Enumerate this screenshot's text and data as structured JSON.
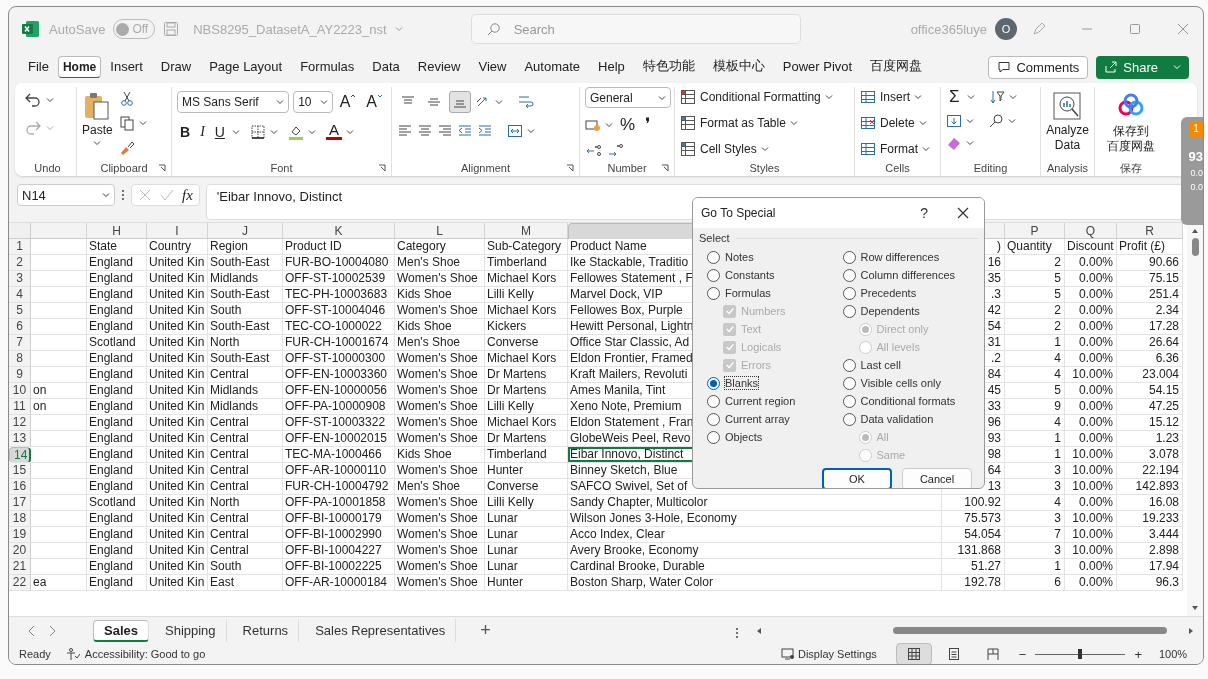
{
  "title_bar": {
    "autosave_label": "AutoSave",
    "autosave_toggle": {
      "on": false,
      "label": "Off"
    },
    "file_name": "NBS8295_DatasetA_AY2223_nst",
    "search_placeholder": "Search",
    "user": "office365luye",
    "avatar_initial": "O"
  },
  "menu_tabs": [
    {
      "label": "File",
      "selected": false
    },
    {
      "label": "Home",
      "selected": true
    },
    {
      "label": "Insert",
      "selected": false
    },
    {
      "label": "Draw",
      "selected": false
    },
    {
      "label": "Page Layout",
      "selected": false
    },
    {
      "label": "Formulas",
      "selected": false
    },
    {
      "label": "Data",
      "selected": false
    },
    {
      "label": "Review",
      "selected": false
    },
    {
      "label": "View",
      "selected": false
    },
    {
      "label": "Automate",
      "selected": false
    },
    {
      "label": "Help",
      "selected": false
    },
    {
      "label": "特色功能",
      "selected": false
    },
    {
      "label": "模板中心",
      "selected": false
    },
    {
      "label": "Power Pivot",
      "selected": false
    },
    {
      "label": "百度网盘",
      "selected": false
    }
  ],
  "comments_button": "Comments",
  "share_button": "Share",
  "ribbon": {
    "group_labels": [
      "Undo",
      "Clipboard",
      "Font",
      "Alignment",
      "Number",
      "Styles",
      "Cells",
      "Editing",
      "Analysis",
      "保存"
    ],
    "paste_label": "Paste",
    "font_name": "MS Sans Serif",
    "font_size": "10",
    "grow_font": "A",
    "shrink_font": "A",
    "style_buttons": [
      "B",
      "I",
      "U"
    ],
    "font_color": "A",
    "vertical_align": [
      {
        "kind": "top",
        "selected": false
      },
      {
        "kind": "middle",
        "selected": false
      },
      {
        "kind": "bottom",
        "selected": true
      }
    ],
    "number_format": "General",
    "percent": "%",
    "comma": "❜",
    "styles": [
      "Conditional Formatting",
      "Format as Table",
      "Cell Styles"
    ],
    "cells": [
      "Insert",
      "Delete",
      "Format"
    ],
    "autosum": "Σ",
    "analyze_data": "Analyze\nData",
    "baidu_save": [
      "保存到",
      "百度网盘"
    ]
  },
  "formula_bar": {
    "name_box": "N14",
    "fx": "fx",
    "content": "'Eibar Innovo, Distinct"
  },
  "sheet": {
    "column_letters": [
      "H",
      "I",
      "J",
      "K",
      "L",
      "M",
      "P",
      "Q",
      "R"
    ],
    "header_row": {
      "num": "1",
      "state": "State",
      "country": "Country",
      "region": "Region",
      "product_id": "Product ID",
      "category": "Category",
      "sub_category": "Sub-Category",
      "product_name": "Product Name",
      "column_o": ")",
      "quantity": "Quantity",
      "discount": "Discount",
      "profit": "Profit (£)"
    },
    "rows": [
      {
        "num": "2",
        "selected": false,
        "state": "England",
        "country": "United Kin",
        "region": "South-East",
        "product_id": "FUR-BO-10004080",
        "category": "Men's Shoe",
        "sub_category": "Timberland",
        "product_name": "Ike Stackable, Traditio",
        "column_o": "16",
        "quantity": "2",
        "discount": "0.00%",
        "profit": "90.66"
      },
      {
        "num": "3",
        "selected": false,
        "state": "England",
        "country": "United Kin",
        "region": "Midlands",
        "product_id": "OFF-ST-10002539",
        "category": "Women's Shoe",
        "sub_category": "Michael Kors",
        "product_name": "Fellowes Statement , F",
        "column_o": "35",
        "quantity": "5",
        "discount": "0.00%",
        "profit": "75.15"
      },
      {
        "num": "4",
        "selected": false,
        "state": "England",
        "country": "United Kin",
        "region": "South-East",
        "product_id": "TEC-PH-10003683",
        "category": "Kids Shoe",
        "sub_category": "Lilli Kelly",
        "product_name": "Marvel Dock, VIP",
        "column_o": ".3",
        "quantity": "5",
        "discount": "0.00%",
        "profit": "251.4"
      },
      {
        "num": "5",
        "selected": false,
        "state": "England",
        "country": "United Kin",
        "region": "South",
        "product_id": "OFF-ST-10004046",
        "category": "Women's Shoe",
        "sub_category": "Michael Kors",
        "product_name": "Fellowes Box, Purple",
        "column_o": "42",
        "quantity": "2",
        "discount": "0.00%",
        "profit": "2.34"
      },
      {
        "num": "6",
        "selected": false,
        "state": "England",
        "country": "United Kin",
        "region": "South-East",
        "product_id": "TEC-CO-1000022",
        "category": "Kids Shoe",
        "sub_category": "Kickers",
        "product_name": "Hewitt Personal, Lightn",
        "column_o": "54",
        "quantity": "2",
        "discount": "0.00%",
        "profit": "17.28"
      },
      {
        "num": "7",
        "selected": false,
        "state": "Scotland",
        "country": "United Kin",
        "region": "North",
        "product_id": "FUR-CH-10001674",
        "category": "Men's Shoe",
        "sub_category": "Converse",
        "product_name": "Office Star Classic, Ad",
        "column_o": "31",
        "quantity": "1",
        "discount": "0.00%",
        "profit": "26.64"
      },
      {
        "num": "8",
        "selected": false,
        "state": "England",
        "country": "United Kin",
        "region": "South-East",
        "product_id": "OFF-ST-10000300",
        "category": "Women's Shoe",
        "sub_category": "Michael Kors",
        "product_name": "Eldon Frontier, Framed",
        "column_o": ".2",
        "quantity": "4",
        "discount": "0.00%",
        "profit": "6.36"
      },
      {
        "num": "9",
        "selected": false,
        "state": "England",
        "country": "United Kin",
        "region": "Central",
        "product_id": "OFF-EN-10003360",
        "category": "Women's Shoe",
        "sub_category": "Dr Martens",
        "product_name": "Kraft Mailers, Revoluti",
        "column_o": "84",
        "quantity": "4",
        "discount": "10.00%",
        "profit": "23.004"
      },
      {
        "num": "10",
        "selected": false,
        "column_g": "on",
        "state": "England",
        "country": "United Kin",
        "region": "Midlands",
        "product_id": "OFF-EN-10000056",
        "category": "Women's Shoe",
        "sub_category": "Dr Martens",
        "product_name": "Ames Manila, Tint",
        "column_o": "45",
        "quantity": "5",
        "discount": "0.00%",
        "profit": "54.15"
      },
      {
        "num": "11",
        "selected": false,
        "column_g": "on",
        "state": "England",
        "country": "United Kin",
        "region": "Midlands",
        "product_id": "OFF-PA-10000908",
        "category": "Women's Shoe",
        "sub_category": "Lilli Kelly",
        "product_name": "Xeno Note, Premium",
        "column_o": "33",
        "quantity": "9",
        "discount": "0.00%",
        "profit": "47.25"
      },
      {
        "num": "12",
        "selected": false,
        "state": "England",
        "country": "United Kin",
        "region": "Central",
        "product_id": "OFF-ST-10003322",
        "category": "Women's Shoe",
        "sub_category": "Michael Kors",
        "product_name": "Eldon Statement , Fran",
        "column_o": "96",
        "quantity": "4",
        "discount": "0.00%",
        "profit": "15.12"
      },
      {
        "num": "13",
        "selected": false,
        "state": "England",
        "country": "United Kin",
        "region": "Central",
        "product_id": "OFF-EN-10002015",
        "category": "Women's Shoe",
        "sub_category": "Dr Martens",
        "product_name": "GlobeWeis Peel, Revo",
        "column_o": "93",
        "quantity": "1",
        "discount": "0.00%",
        "profit": "1.23"
      },
      {
        "num": "14",
        "selected": true,
        "state": "England",
        "country": "United Kin",
        "region": "Central",
        "product_id": "TEC-MA-1000466",
        "category": "Kids Shoe",
        "sub_category": "Timberland",
        "product_name": "Eibar Innovo, Distinct",
        "column_o": "98",
        "quantity": "1",
        "discount": "10.00%",
        "profit": "3.078"
      },
      {
        "num": "15",
        "selected": false,
        "state": "England",
        "country": "United Kin",
        "region": "Central",
        "product_id": "OFF-AR-10000110",
        "category": "Women's Shoe",
        "sub_category": "Hunter",
        "product_name": "Binney Sketch, Blue",
        "column_o": "64",
        "quantity": "3",
        "discount": "10.00%",
        "profit": "22.194"
      },
      {
        "num": "16",
        "selected": false,
        "state": "England",
        "country": "United Kin",
        "region": "Central",
        "product_id": "FUR-CH-10004792",
        "category": "Men's Shoe",
        "sub_category": "Converse",
        "product_name": "SAFCO Swivel, Set of",
        "column_o": "13",
        "quantity": "3",
        "discount": "10.00%",
        "profit": "142.893"
      },
      {
        "num": "17",
        "selected": false,
        "state": "Scotland",
        "country": "United Kin",
        "region": "North",
        "product_id": "OFF-PA-10001858",
        "category": "Women's Shoe",
        "sub_category": "Lilli Kelly",
        "product_name": "Sandy Chapter, Multicolor",
        "column_o": "100.92",
        "quantity": "4",
        "discount": "0.00%",
        "profit": "16.08"
      },
      {
        "num": "18",
        "selected": false,
        "state": "England",
        "country": "United Kin",
        "region": "Central",
        "product_id": "OFF-BI-10000179",
        "category": "Women's Shoe",
        "sub_category": "Lunar",
        "product_name": "Wilson Jones 3-Hole, Economy",
        "column_o": "75.573",
        "quantity": "3",
        "discount": "10.00%",
        "profit": "19.233"
      },
      {
        "num": "19",
        "selected": false,
        "state": "England",
        "country": "United Kin",
        "region": "Central",
        "product_id": "OFF-BI-10002990",
        "category": "Women's Shoe",
        "sub_category": "Lunar",
        "product_name": "Acco Index, Clear",
        "column_o": "54.054",
        "quantity": "7",
        "discount": "10.00%",
        "profit": "3.444"
      },
      {
        "num": "20",
        "selected": false,
        "state": "England",
        "country": "United Kin",
        "region": "Central",
        "product_id": "OFF-BI-10004227",
        "category": "Women's Shoe",
        "sub_category": "Lunar",
        "product_name": "Avery Brooke, Economy",
        "column_o": "131.868",
        "quantity": "3",
        "discount": "10.00%",
        "profit": "2.898"
      },
      {
        "num": "21",
        "selected": false,
        "state": "England",
        "country": "United Kin",
        "region": "South",
        "product_id": "OFF-BI-10002225",
        "category": "Women's Shoe",
        "sub_category": "Lunar",
        "product_name": "Cardinal Brooke, Durable",
        "column_o": "51.27",
        "quantity": "1",
        "discount": "0.00%",
        "profit": "17.94"
      },
      {
        "num": "22",
        "selected": false,
        "column_g": "ea",
        "state": "England",
        "country": "United Kin",
        "region": "East",
        "product_id": "OFF-AR-10000184",
        "category": "Women's Shoe",
        "sub_category": "Hunter",
        "product_name": "Boston Sharp, Water Color",
        "column_o": "192.78",
        "quantity": "6",
        "discount": "0.00%",
        "profit": "96.3"
      }
    ]
  },
  "dialog": {
    "title": "Go To Special",
    "help": "?",
    "section": "Select",
    "columns": [
      [
        {
          "kind": "radio",
          "label": "Notes",
          "selected": false
        },
        {
          "kind": "radio",
          "label": "Constants",
          "selected": false
        },
        {
          "kind": "radio",
          "label": "Formulas",
          "selected": false,
          "children": [
            {
              "kind": "checkbox",
              "label": "Numbers",
              "checked": true,
              "disabled": true
            },
            {
              "kind": "checkbox",
              "label": "Text",
              "checked": true,
              "disabled": true
            },
            {
              "kind": "checkbox",
              "label": "Logicals",
              "checked": true,
              "disabled": true
            },
            {
              "kind": "checkbox",
              "label": "Errors",
              "checked": true,
              "disabled": true
            }
          ]
        },
        {
          "kind": "radio",
          "label": "Blanks",
          "selected": true
        },
        {
          "kind": "radio",
          "label": "Current region",
          "selected": false
        },
        {
          "kind": "radio",
          "label": "Current array",
          "selected": false
        },
        {
          "kind": "radio",
          "label": "Objects",
          "selected": false
        }
      ],
      [
        {
          "kind": "radio",
          "label": "Row differences",
          "selected": false
        },
        {
          "kind": "radio",
          "label": "Column differences",
          "selected": false
        },
        {
          "kind": "radio",
          "label": "Precedents",
          "selected": false
        },
        {
          "kind": "radio",
          "label": "Dependents",
          "selected": false,
          "children": [
            {
              "kind": "radio",
              "label": "Direct only",
              "selected": true,
              "disabled": true
            },
            {
              "kind": "radio",
              "label": "All levels",
              "selected": false,
              "disabled": true
            }
          ]
        },
        {
          "kind": "radio",
          "label": "Last cell",
          "selected": false
        },
        {
          "kind": "radio",
          "label": "Visible cells only",
          "selected": false
        },
        {
          "kind": "radio",
          "label": "Conditional formats",
          "selected": false
        },
        {
          "kind": "radio",
          "label": "Data validation",
          "selected": false,
          "children": [
            {
              "kind": "radio",
              "label": "All",
              "selected": true,
              "disabled": true
            },
            {
              "kind": "radio",
              "label": "Same",
              "selected": false,
              "disabled": true
            }
          ]
        }
      ]
    ],
    "buttons": [
      {
        "label": "OK",
        "default": true
      },
      {
        "label": "Cancel",
        "default": false
      }
    ]
  },
  "sheet_tabs": [
    {
      "label": "Sales",
      "selected": true
    },
    {
      "label": "Shipping",
      "selected": false
    },
    {
      "label": "Returns",
      "selected": false
    },
    {
      "label": "Sales Representatives",
      "selected": false
    }
  ],
  "add_sheet": "+",
  "status_bar": {
    "ready": "Ready",
    "accessibility": "Accessibility: Good to go",
    "display_settings": "Display Settings",
    "views": [
      {
        "kind": "normal",
        "selected": true
      },
      {
        "kind": "page_layout",
        "selected": false
      },
      {
        "kind": "page_break",
        "selected": false
      }
    ],
    "zoom_minus": "−",
    "zoom_plus": "+",
    "zoom": {
      "level": 0.5
    },
    "zoom_reading": "100%"
  },
  "side_widget": {
    "badge": "1",
    "score": "93",
    "up_speed": "0.0",
    "down_speed": "0.0"
  }
}
